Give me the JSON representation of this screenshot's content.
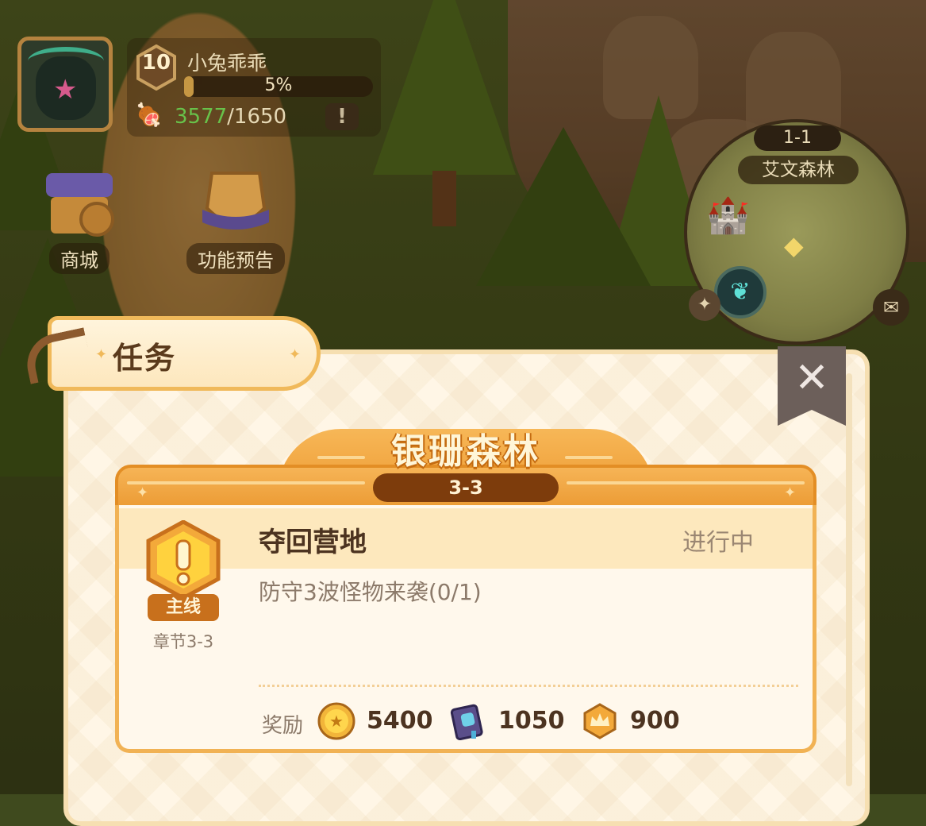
{
  "player": {
    "level": "10",
    "name": "小兔乖乖",
    "exp_percent_text": "5%",
    "exp_fraction": 0.05,
    "food_current": "3577",
    "food_max": "/1650",
    "warning_symbol": "!"
  },
  "menu": {
    "shop_label": "商城",
    "preview_label": "功能预告"
  },
  "minimap": {
    "stage": "1-1",
    "area_name": "艾文森林"
  },
  "panel": {
    "tab_title": "任务",
    "close_symbol": "✕",
    "chapter_name": "银珊森林",
    "chapter_stage": "3-3"
  },
  "quest": {
    "title": "夺回营地",
    "status": "进行中",
    "description": "防守3波怪物来袭(0/1)",
    "type_tag": "主线",
    "chapter": "章节3-3",
    "reward_label": "奖励",
    "rewards": [
      {
        "icon": "gold-coin-icon",
        "value": "5400"
      },
      {
        "icon": "skill-book-icon",
        "value": "1050"
      },
      {
        "icon": "exp-crown-icon",
        "value": "900"
      }
    ]
  },
  "colors": {
    "accent_orange": "#eb9a33",
    "panel_bg": "#fff6e6",
    "food_current": "#68c24a"
  }
}
